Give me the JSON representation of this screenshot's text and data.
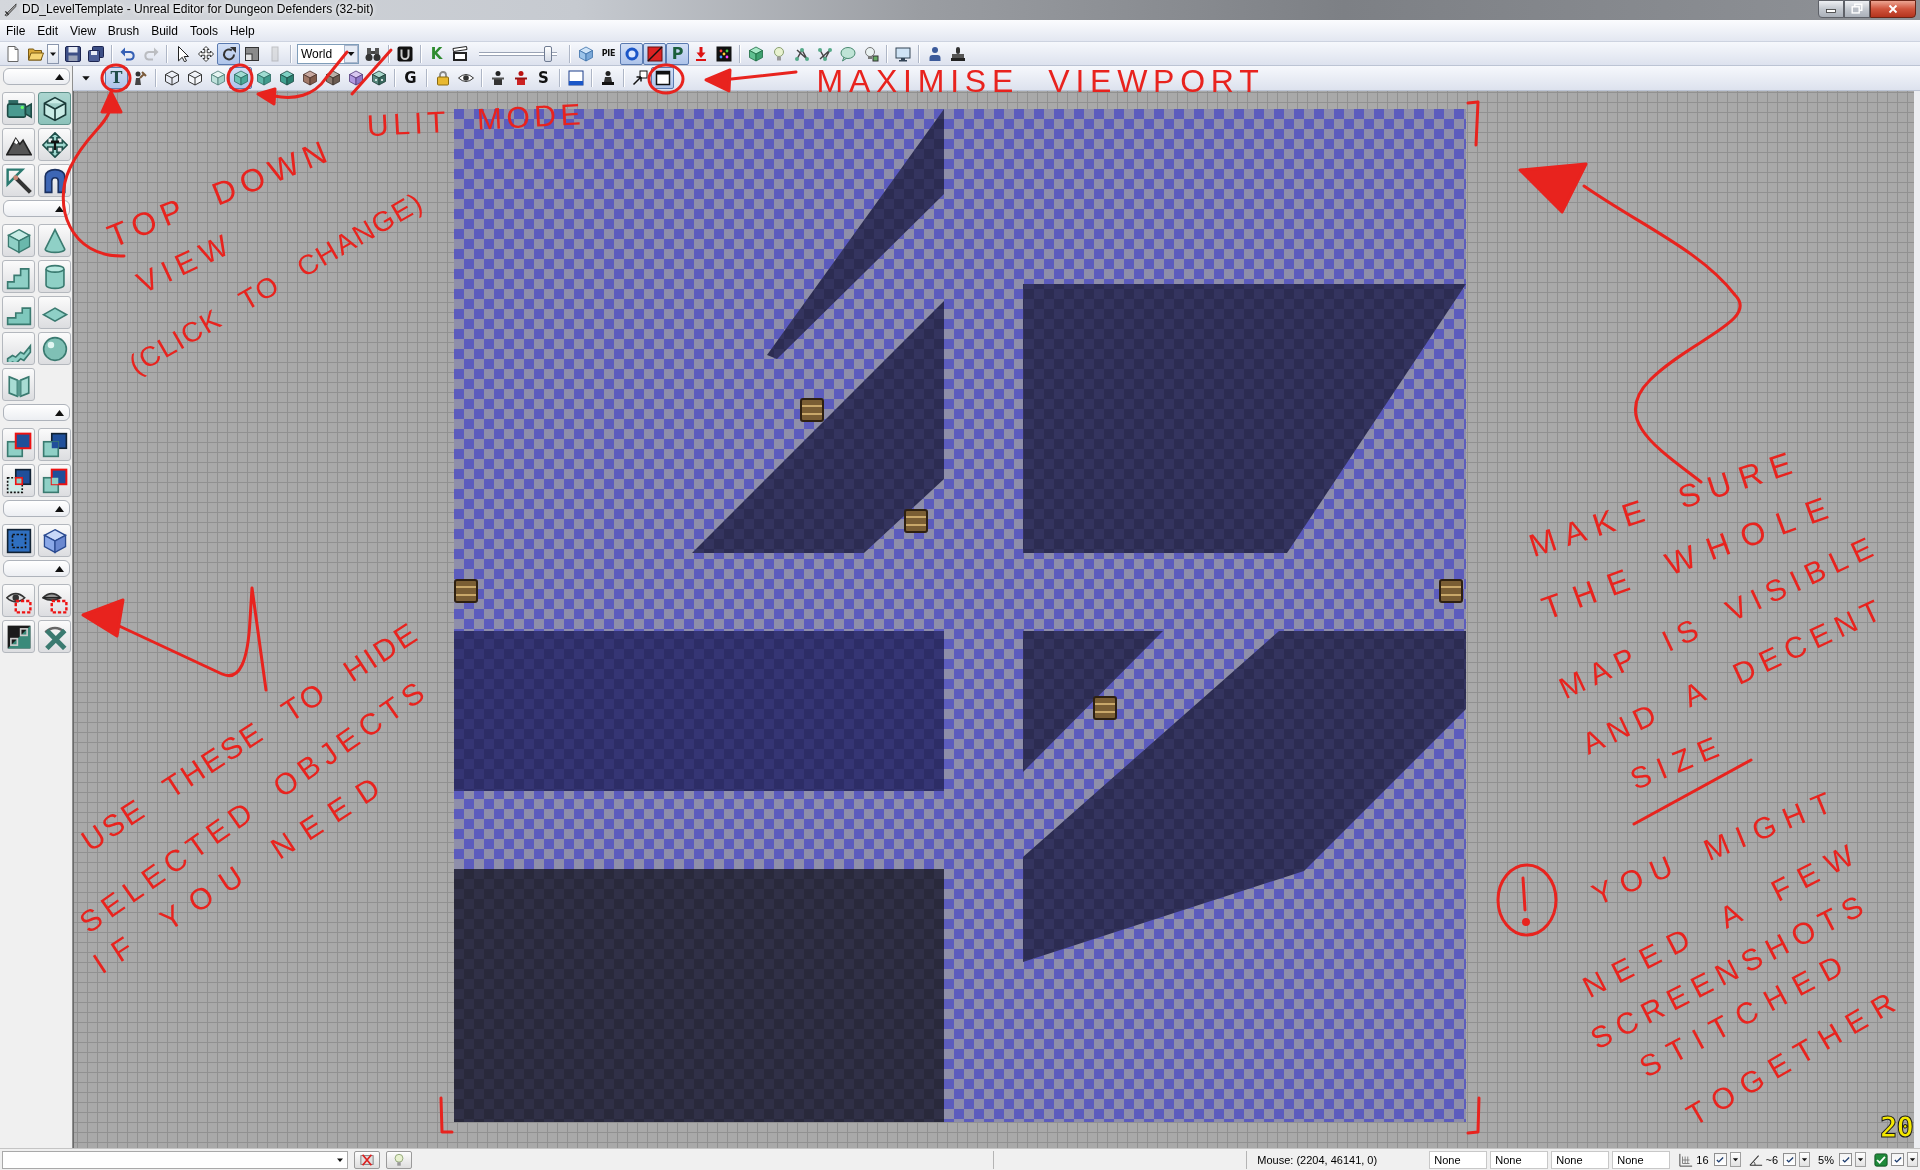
{
  "window": {
    "title": "DD_LevelTemplate - Unreal Editor for Dungeon Defenders (32-bit)"
  },
  "menu": [
    "File",
    "Edit",
    "View",
    "Brush",
    "Build",
    "Tools",
    "Help"
  ],
  "toolbar_1": {
    "groups": [
      [
        {
          "kind": "button",
          "pressed": false,
          "disabled": false
        },
        {
          "kind": "split",
          "pressed": false,
          "disabled": false
        },
        {
          "kind": "button",
          "pressed": false,
          "disabled": false
        },
        {
          "kind": "button",
          "pressed": false,
          "disabled": false
        }
      ],
      [
        {
          "kind": "button",
          "pressed": false,
          "disabled": false
        },
        {
          "kind": "button",
          "pressed": false,
          "disabled": true
        }
      ],
      [
        {
          "kind": "button",
          "pressed": false,
          "disabled": false
        },
        {
          "kind": "button",
          "pressed": false,
          "disabled": false
        },
        {
          "kind": "button",
          "pressed": true,
          "disabled": false
        },
        {
          "kind": "button",
          "pressed": false,
          "disabled": false
        },
        {
          "kind": "button",
          "pressed": false,
          "disabled": true
        }
      ],
      [
        {
          "kind": "dropdown",
          "value": "World"
        },
        {
          "kind": "button",
          "pressed": false,
          "disabled": false
        }
      ],
      [
        {
          "kind": "button",
          "pressed": false,
          "disabled": false
        }
      ],
      [
        {
          "kind": "text",
          "label": "K",
          "pressed": false,
          "disabled": false
        },
        {
          "kind": "button",
          "pressed": false,
          "disabled": false
        },
        {
          "kind": "slider",
          "level": 0.93
        }
      ],
      [
        {
          "kind": "button",
          "pressed": false,
          "disabled": false
        },
        {
          "kind": "text",
          "label": "PIE",
          "pressed": false,
          "disabled": false
        },
        {
          "kind": "button",
          "pressed": true,
          "disabled": false
        },
        {
          "kind": "button",
          "pressed": true,
          "disabled": false
        },
        {
          "kind": "text",
          "label": "P",
          "pressed": true,
          "disabled": false
        },
        {
          "kind": "button",
          "pressed": false,
          "disabled": false
        },
        {
          "kind": "button",
          "pressed": false,
          "disabled": false
        }
      ],
      [
        {
          "kind": "button",
          "pressed": false,
          "disabled": false
        },
        {
          "kind": "button",
          "pressed": false,
          "disabled": false
        },
        {
          "kind": "button",
          "pressed": false,
          "disabled": false
        },
        {
          "kind": "button",
          "pressed": false,
          "disabled": false
        },
        {
          "kind": "button",
          "pressed": false,
          "disabled": false
        },
        {
          "kind": "button",
          "pressed": false,
          "disabled": false
        }
      ],
      [
        {
          "kind": "button",
          "pressed": false,
          "disabled": false
        }
      ],
      [
        {
          "kind": "button",
          "pressed": false,
          "disabled": false
        },
        {
          "kind": "button",
          "pressed": false,
          "disabled": false
        }
      ]
    ]
  },
  "toolbar_2": {
    "groups": [
      [
        {
          "kind": "text",
          "label": "T",
          "pressed": true
        },
        {
          "kind": "button",
          "pressed": false
        }
      ],
      [
        {
          "kind": "button",
          "pressed": false
        },
        {
          "kind": "button",
          "pressed": false
        },
        {
          "kind": "button",
          "pressed": false
        },
        {
          "kind": "button",
          "pressed": true
        },
        {
          "kind": "button",
          "pressed": false
        },
        {
          "kind": "button",
          "pressed": false
        },
        {
          "kind": "button",
          "pressed": false
        },
        {
          "kind": "button",
          "pressed": false
        },
        {
          "kind": "button",
          "pressed": false
        },
        {
          "kind": "button",
          "pressed": false
        }
      ],
      [
        {
          "kind": "text",
          "label": "G",
          "pressed": false
        }
      ],
      [
        {
          "kind": "button",
          "pressed": false
        },
        {
          "kind": "button",
          "pressed": false
        }
      ],
      [
        {
          "kind": "button",
          "pressed": false
        },
        {
          "kind": "button",
          "pressed": false
        },
        {
          "kind": "text",
          "label": "S",
          "pressed": false
        }
      ],
      [
        {
          "kind": "button",
          "pressed": false
        }
      ],
      [
        {
          "kind": "button",
          "pressed": false
        }
      ],
      [
        {
          "kind": "button",
          "pressed": false
        },
        {
          "kind": "button",
          "pressed": true
        }
      ]
    ]
  },
  "tool_panel": {
    "sections": [
      {
        "expanded": true,
        "buttons": [
          {
            "selected": false
          },
          {
            "selected": true
          },
          {
            "selected": false
          },
          {
            "selected": false
          },
          {
            "selected": false
          },
          {
            "selected": false
          }
        ]
      },
      {
        "expanded": true
      },
      {
        "expanded": true
      },
      {
        "expanded": true
      },
      {
        "expanded": true
      }
    ]
  },
  "viewport": {
    "counter": "20"
  },
  "status_bar": {
    "mouse": "Mouse: (2204, 46141, 0)",
    "fields": [
      "None",
      "None",
      "None",
      "None"
    ],
    "snaps": [
      {
        "kind": "grid",
        "value": "16",
        "checked": true
      },
      {
        "kind": "angle",
        "value": "~6",
        "checked": true
      },
      {
        "kind": "scale",
        "value": "5%",
        "checked": true
      },
      {
        "kind": "toggle",
        "checked": true
      }
    ]
  },
  "annotations": [
    {
      "lines": [
        [
          "MAXIMISE",
          "VIEWPORT"
        ]
      ]
    },
    {
      "lines": [
        [
          "ULIT",
          "MODE"
        ]
      ]
    },
    {
      "lines": [
        [
          "TOP",
          "DOWN"
        ],
        [
          "VIEW"
        ],
        [
          "(CLICK",
          "TO",
          "CHANGE)"
        ]
      ]
    },
    {
      "lines": [
        [
          "MAKE",
          "SURE"
        ],
        [
          "THE",
          "WHOLE"
        ],
        [
          "MAP",
          "IS",
          "VISIBLE"
        ],
        [
          "AND",
          "A",
          "DECENT"
        ],
        [
          "SIZE"
        ]
      ]
    },
    {
      "lines": [
        [
          "USE",
          "THESE",
          "TO",
          "HIDE"
        ],
        [
          "SELECTED",
          "OBJECTS"
        ],
        [
          "IF",
          "YOU",
          "NEED"
        ]
      ]
    },
    {
      "lines": [
        [
          "YOU",
          "MIGHT"
        ],
        [
          "NEED",
          "A",
          "FEW"
        ],
        [
          "SCREENSHOTS"
        ],
        [
          "STITCHED"
        ],
        [
          "TOGETHER"
        ]
      ]
    }
  ]
}
